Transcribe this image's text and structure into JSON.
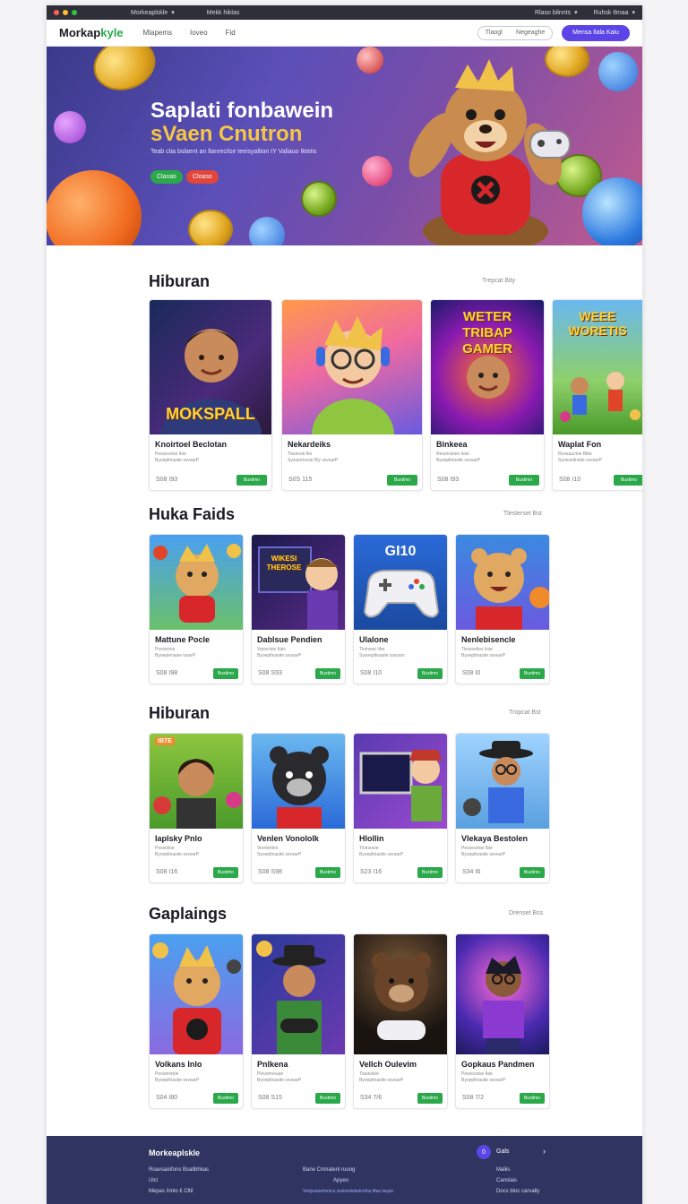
{
  "chrome": {
    "tab_label": "Morkeaplskle",
    "address": "Mekk hiklas",
    "menu_a": "Rlaso bilnnts",
    "menu_b": "Ruhsk tlmaa"
  },
  "nav": {
    "logo_main": "Morkap",
    "logo_accent": "kyle",
    "links": [
      "Mlapems",
      "Ioveo",
      "Fid"
    ],
    "search_a": "Tlaogl",
    "search_b": "Negeaghe",
    "signup": "Mensa Ilala Kaiu"
  },
  "hero": {
    "title_line1": "Saplati fonbawein",
    "title_line2": "sVaen Cnutron",
    "subtitle": "Teab ctia bslaent an llanrecilse teeisyaltion tY Valiauo Ikteiis",
    "btn_green": "Clanas",
    "btn_red": "Cloaso",
    "colors": {
      "green": "#2aa84a",
      "red": "#e2463a",
      "gold": "#f6c744"
    }
  },
  "sections": [
    {
      "title": "Hiburan",
      "more": "Trepcat Bity",
      "cards": [
        {
          "title": "Knoirtoel Beclotan",
          "meta1": "Pesseurtoe Ibie",
          "meta2": "Byoepltnasite ssvsarP",
          "price": "S08  I93",
          "btn": "Bustimo",
          "img_label": "MOKSPALL"
        },
        {
          "title": "Nekardeiks",
          "meta1": "Tlaoersb Ilio",
          "meta2": "Sysopvtrsoie Bly ssvsarP",
          "price": "S0S  115",
          "btn": "Bustimo",
          "img_label": ""
        },
        {
          "title": "Binkeea",
          "meta1": "Reoeivioiee Iiaio",
          "meta2": "Byoepltnosite ssvsarP",
          "price": "S08  I93",
          "btn": "Bustimo",
          "img_label": "WETER TRIBAP GAMER"
        },
        {
          "title": "Waplat Fon",
          "meta1": "Rossauctoe Bibe",
          "meta2": "Syoeseltnsite ssvsarP",
          "price": "S08  I10",
          "btn": "Bustimo",
          "img_label": "WEEE WORETIS"
        }
      ]
    },
    {
      "title": "Huka Faids",
      "more": "Tlesterset Bst",
      "cards": [
        {
          "title": "Mattune Pocle",
          "meta1": "Psvoertos",
          "meta2": "Byoeplenasie lsasrP",
          "price": "S08  I98",
          "btn": "Bustimo",
          "img_label": ""
        },
        {
          "title": "Dablsue Pendien",
          "meta1": "Vanocisie Iiaio",
          "meta2": "Byoepltnasite ssvsarP",
          "price": "S08  S93",
          "btn": "Bustimo",
          "img_label": "WIKESI THEROSE"
        },
        {
          "title": "Ulalone",
          "meta1": "Tloinese Iibe",
          "meta2": "Sysoepltnasite sssvsor",
          "price": "S08  I10",
          "btn": "Bustimo",
          "img_label": "GI10"
        },
        {
          "title": "Nenlebisencle",
          "meta1": "Tlearseltos Iisie",
          "meta2": "Byoepltnasite ssvsarP",
          "price": "S08  I0",
          "btn": "Bustimo",
          "img_label": ""
        }
      ]
    },
    {
      "title": "Hiburan",
      "more": "Tropcat Bst",
      "cards": [
        {
          "title": "Iaplsky Pnlo",
          "meta1": "Pesoisloe",
          "meta2": "Byoepltnasite ssvsarP",
          "price": "S08  I16",
          "btn": "Bustimo",
          "img_label": "IBTE"
        },
        {
          "title": "Venlen Vonololk",
          "meta1": "Veviorirtes",
          "meta2": "Syoepltnasite ssvsarP",
          "price": "S08  S98",
          "btn": "Bustimo",
          "img_label": ""
        },
        {
          "title": "Hlollin",
          "meta1": "Tloinesoe",
          "meta2": "Byoepltnasite ssvsarP",
          "price": "S23  I16",
          "btn": "Bustimo",
          "img_label": ""
        },
        {
          "title": "Vlekaya Bestolen",
          "meta1": "Pesseurtoe Ibie",
          "meta2": "Byoepltnasite ssvsarP",
          "price": "S34  I6",
          "btn": "Bustimo",
          "img_label": ""
        }
      ]
    },
    {
      "title": "Gaplaings",
      "more": "Drenset Bss",
      "cards": [
        {
          "title": "Volkans Inlo",
          "meta1": "Pesoimirtoe",
          "meta2": "Byoepltnasite ssvsarP",
          "price": "S04  I80",
          "btn": "Bustimo",
          "img_label": ""
        },
        {
          "title": "Pnlkena",
          "meta1": "Plevorioeuae",
          "meta2": "Byoepltnasite ssvsarP",
          "price": "S08  S15",
          "btn": "Bustimo",
          "img_label": ""
        },
        {
          "title": "Vellch Oulevim",
          "meta1": "Tlaoirstoe",
          "meta2": "Byoepltnasite ssvsarP",
          "price": "S34  7/6",
          "btn": "Bustimo",
          "img_label": ""
        },
        {
          "title": "Gopkaus Pandmen",
          "meta1": "Pesseurtoe Ibie",
          "meta2": "Byoepltnasite ssvsarP",
          "price": "S08  7/2",
          "btn": "Bustimo",
          "img_label": ""
        }
      ]
    }
  ],
  "footer": {
    "brand": "Morkeaplskle",
    "col1": [
      "Roavsaiofons Bsalibhkas",
      "Ulcl",
      "Mepas Innlo  £ Cltil"
    ],
    "col2": [
      "Bane Cnmatenl ruoog",
      "Apyeo",
      "Vedyeaselmmcs ssvtorelekstnsfns Mas lasyie"
    ],
    "badge": "0",
    "right_title": "Gals",
    "right_items": [
      "Maliis",
      "Canslais",
      "Docs bloc carvally"
    ]
  }
}
